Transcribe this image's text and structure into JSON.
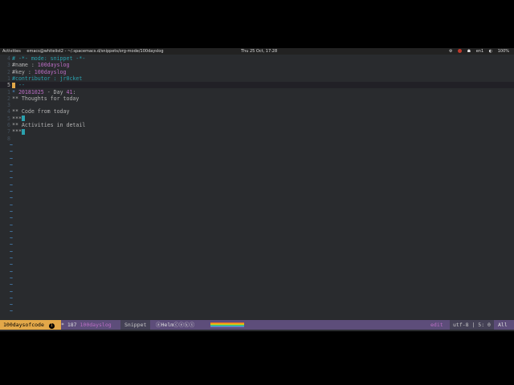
{
  "topbar": {
    "activities": "Activities",
    "app_title": "emacs@whitelist2 - ~/.spacemacs.d/snippets/org-mode/100dayslog",
    "clock": "Thu 25 Oct, 17:28",
    "lang": "en1",
    "battery": "100%"
  },
  "editor": {
    "lines": [
      {
        "num": "4",
        "parts": [
          {
            "t": "# -*- mode: snippet -*-",
            "c": "c"
          }
        ]
      },
      {
        "num": "3",
        "parts": [
          {
            "t": "#name : ",
            "c": ""
          },
          {
            "t": "100dayslog",
            "c": "v"
          }
        ]
      },
      {
        "num": "2",
        "parts": [
          {
            "t": "#key : ",
            "c": ""
          },
          {
            "t": "100dayslog",
            "c": "v"
          }
        ]
      },
      {
        "num": "1",
        "parts": [
          {
            "t": "#contributor : jr0cket",
            "c": "c"
          }
        ]
      },
      {
        "num": "5",
        "parts": [
          {
            "t": " --",
            "c": "c"
          }
        ],
        "current": true
      },
      {
        "num": "1",
        "parts": [
          {
            "t": "* ",
            "c": "h1"
          },
          {
            "t": "20181025",
            "c": "date"
          },
          {
            "t": " - Day ",
            "c": "day"
          },
          {
            "t": "41",
            "c": "v"
          },
          {
            "t": ":",
            "c": "day"
          }
        ]
      },
      {
        "num": "2",
        "parts": [
          {
            "t": "** Thoughts for today",
            "c": ""
          }
        ]
      },
      {
        "num": "3",
        "parts": []
      },
      {
        "num": "4",
        "parts": [
          {
            "t": "** Code from today",
            "c": ""
          }
        ]
      },
      {
        "num": "5",
        "parts": [
          {
            "t": "***",
            "c": ""
          }
        ],
        "cursor2": true
      },
      {
        "num": "6",
        "parts": [
          {
            "t": "** Activities in detail",
            "c": ""
          }
        ]
      },
      {
        "num": "7",
        "parts": [
          {
            "t": "***",
            "c": ""
          }
        ],
        "cursor2": true
      },
      {
        "num": "8",
        "parts": []
      }
    ],
    "tilde": "~"
  },
  "modeline": {
    "workspace": "100daysofcode",
    "workspace_num": "1",
    "modified": "*",
    "size": "187",
    "buffer_name": "100dayslog",
    "major_mode": "Snippet",
    "minor_modes": "ⓐHelmⓒⓔⓚⓢ",
    "state": "edit",
    "encoding": "utf-8 | 5: 0",
    "position": "All"
  },
  "colors": {
    "background": "#292b2e",
    "modeline": "#5d4d7a",
    "workspace": "#e3a849",
    "keyword": "#4f97d7",
    "string": "#bc6ec5",
    "comment": "#2aa1ae"
  }
}
